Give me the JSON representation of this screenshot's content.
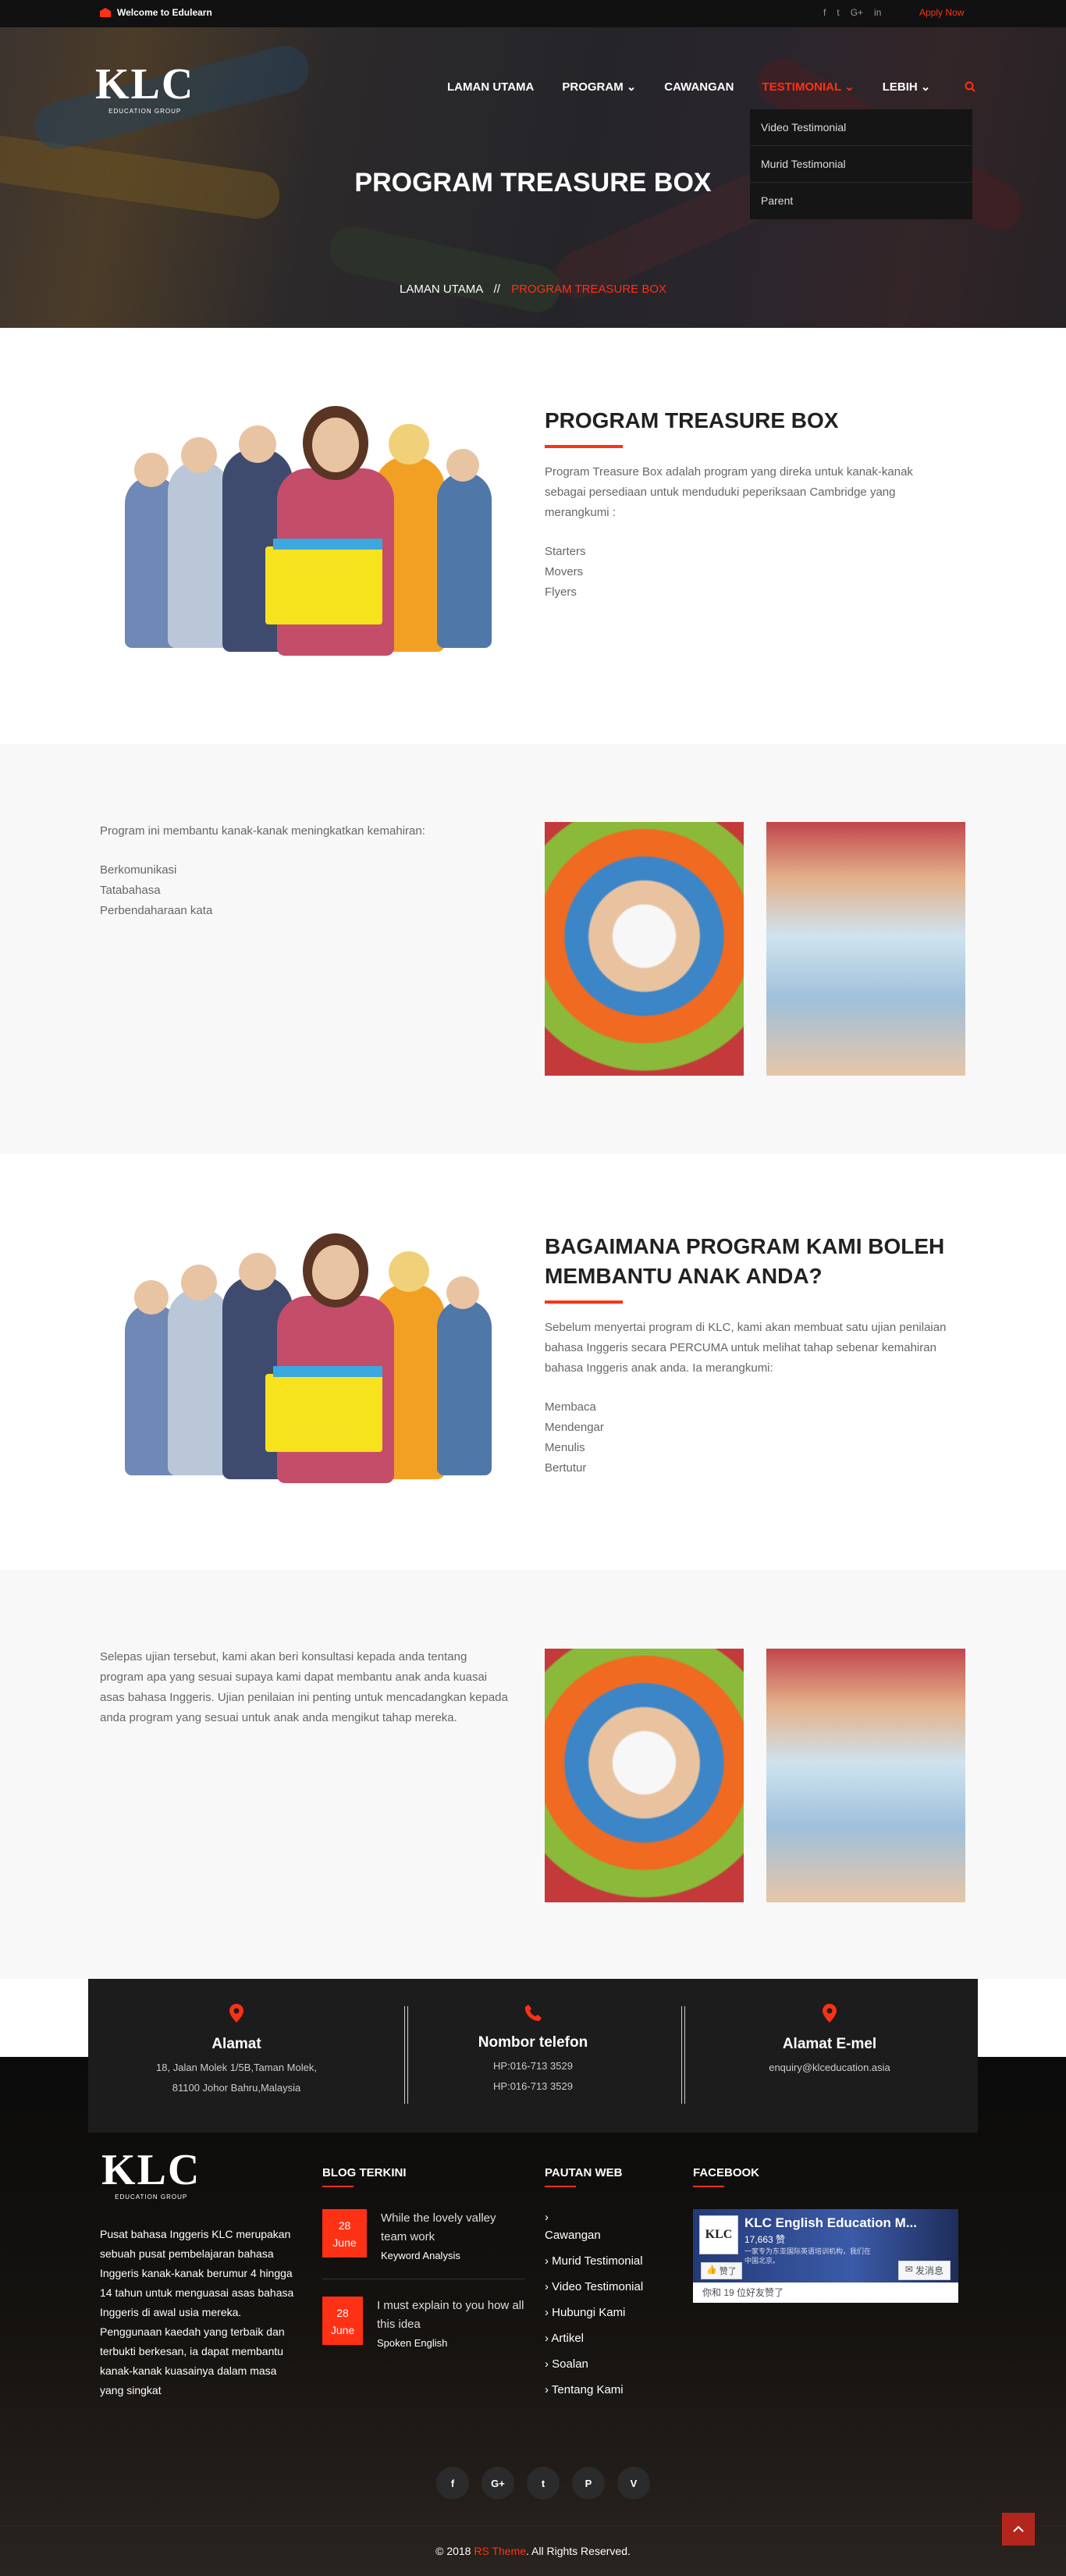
{
  "topbar": {
    "welcome": "Welcome to Edulearn",
    "social": [
      "f",
      "t",
      "G+",
      "in"
    ],
    "apply": "Apply Now"
  },
  "logo": {
    "mark": "KLC",
    "sub": "EDUCATION GROUP"
  },
  "nav": {
    "items": [
      "LAMAN UTAMA",
      "PROGRAM",
      "CAWANGAN",
      "TESTIMONIAL",
      "LEBIH"
    ],
    "active": "TESTIMONIAL"
  },
  "dropdown": [
    "Video Testimonial",
    "Murid Testimonial",
    "Parent"
  ],
  "hero": {
    "title": "PROGRAM TREASURE BOX",
    "breadcrumb_home": "LAMAN UTAMA",
    "breadcrumb_sep": "//",
    "breadcrumb_current": "PROGRAM TREASURE BOX"
  },
  "section1": {
    "title": "PROGRAM TREASURE BOX",
    "text": "Program Treasure Box adalah program yang direka untuk kanak-kanak sebagai persediaan untuk menduduki peperiksaan Cambridge yang merangkumi :",
    "items": [
      "Starters",
      "Movers",
      "Flyers"
    ]
  },
  "section2": {
    "text": "Program ini membantu kanak-kanak meningkatkan kemahiran:",
    "items": [
      "Berkomunikasi",
      "Tatabahasa",
      "Perbendaharaan kata"
    ]
  },
  "section3": {
    "title": "BAGAIMANA PROGRAM KAMI BOLEH MEMBANTU ANAK ANDA?",
    "text": "Sebelum menyertai program di KLC, kami akan membuat satu ujian penilaian bahasa Inggeris secara PERCUMA untuk melihat tahap sebenar kemahiran bahasa Inggeris anak anda. Ia merangkumi:",
    "items": [
      "Membaca",
      "Mendengar",
      "Menulis",
      "Bertutur"
    ]
  },
  "section4": {
    "text": "Selepas ujian tersebut, kami akan beri konsultasi kepada anda tentang program apa yang sesuai supaya kami dapat membantu anak anda kuasai asas bahasa Inggeris. Ujian penilaian ini penting untuk mencadangkan kepada anda program yang sesuai untuk anak anda mengikut tahap mereka."
  },
  "contact": [
    {
      "title": "Alamat",
      "lines": [
        "18, Jalan Molek 1/5B,Taman Molek,",
        "81100 Johor Bahru,Malaysia"
      ]
    },
    {
      "title": "Nombor telefon",
      "lines": [
        "HP:016-713 3529",
        "HP:016-713 3529"
      ]
    },
    {
      "title": "Alamat E-mel",
      "lines": [
        "enquiry@klceducation.asia"
      ]
    }
  ],
  "footer": {
    "about": "Pusat bahasa Inggeris KLC merupakan sebuah pusat pembelajaran bahasa Inggeris kanak-kanak berumur 4 hingga 14 tahun untuk menguasai asas bahasa Inggeris di awal usia mereka. Penggunaan kaedah yang terbaik dan terbukti berkesan, ia dapat membantu kanak-kanak kuasainya dalam masa yang singkat",
    "blog_heading": "BLOG TERKINI",
    "posts": [
      {
        "day": "28",
        "month": "June",
        "title": "While the lovely valley team work",
        "category": "Keyword Analysis"
      },
      {
        "day": "28",
        "month": "June",
        "title": "I must explain to you how all this idea",
        "category": "Spoken English"
      }
    ],
    "links_heading": "PAUTAN WEB",
    "links": [
      "Cawangan",
      "Murid Testimonial",
      "Video Testimonial",
      "Hubungi Kami",
      "Artikel",
      "Soalan",
      "Tentang Kami"
    ],
    "facebook_heading": "FACEBOOK",
    "fb": {
      "name": "KLC English Education M...",
      "likes": "17,663 赞",
      "desc": "一家专为东亚国际英语培训机构，我们在中国北京。",
      "button": "发消息",
      "liked": "赞了",
      "friends": "你和 19 位好友赞了"
    },
    "social": [
      "f",
      "G+",
      "t",
      "P",
      "V"
    ],
    "copyright_pre": "© 2018 ",
    "copyright_brand": "RS Theme",
    "copyright_post": ". All Rights Reserved."
  }
}
